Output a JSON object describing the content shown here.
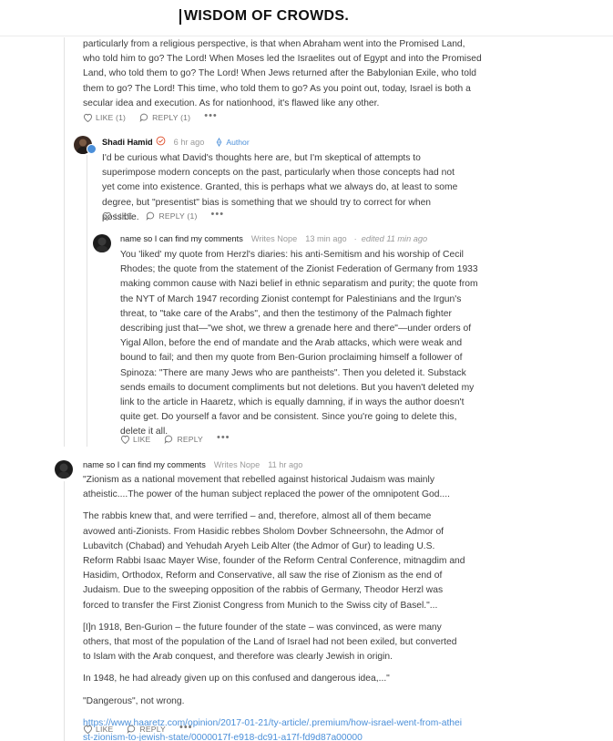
{
  "header": {
    "logo": "WISDOM OF CROWDS."
  },
  "colors": {
    "link": "#4b8fd9",
    "author_badge": "#4b8fd9",
    "verified": "#e05a3a",
    "text": "#363737",
    "muted": "#9a9a9a"
  },
  "comment_top": {
    "text": "particularly from a religious perspective, is that when Abraham went into the Promised Land, who told him to go? The Lord! When Moses led the Israelites out of Egypt and into the Promised Land, who told them to go? The Lord! When Jews returned after the Babylonian Exile, who told them to go? The Lord! This time, who told them to go? As you point out, today, Israel is both a secular idea and execution. As for nationhood, it's flawed like any other.",
    "like_label": "LIKE (1)",
    "reply_label": "REPLY (1)",
    "more": "•••"
  },
  "comment_shadi": {
    "author": "Shadi Hamid",
    "time": "6 hr ago",
    "badge": "Author",
    "text": "I'd be curious what David's thoughts here are, but I'm skeptical of attempts to superimpose modern concepts on the past, particularly when those concepts had not yet come into existence. Granted, this is perhaps what we always do, at least to some degree, but \"presentist\" bias is something that we should try to correct for when possible.",
    "like_label": "LIKE",
    "reply_label": "REPLY (1)",
    "more": "•••"
  },
  "comment_reply": {
    "author": "name so I can find my comments",
    "handle": "Writes Nope",
    "time": "13 min ago",
    "separator": "·",
    "edited": "edited 11 min ago",
    "text": "You 'liked' my quote from Herzl's diaries: his anti-Semitism and his worship of Cecil Rhodes; the quote from the statement of the Zionist Federation of Germany from 1933 making common cause with Nazi belief in ethnic separatism and purity; the quote from the NYT of March 1947 recording Zionist contempt for Palestinians and the Irgun's threat, to \"take care of the Arabs\", and then the testimony of the Palmach fighter describing just that—\"we shot, we threw a grenade here and there\"—under orders of Yigal Allon, before the end of mandate and the Arab attacks, which were weak and bound to fail; and then my quote from Ben-Gurion proclaiming himself a follower of Spinoza: \"There are many Jews who are pantheists\". Then you deleted it. Substack sends emails to document compliments but not deletions. But you haven't deleted my link to the article in Haaretz, which is equally damning, if in ways the author doesn't quite get. Do yourself a favor and be consistent. Since you're going to delete this, delete it all.",
    "like_label": "LIKE",
    "reply_label": "REPLY",
    "more": "•••"
  },
  "comment_bottom": {
    "author": "name so I can find my comments",
    "handle": "Writes Nope",
    "time": "11 hr ago",
    "paragraphs": [
      "\"Zionism as a national movement that rebelled against historical Judaism was mainly atheistic....The power of the human subject replaced the power of the omnipotent God....",
      "The rabbis knew that, and were terrified – and, therefore, almost all of them became avowed anti-Zionists. From Hasidic rebbes Sholom Dovber Schneersohn, the Admor of Lubavitch (Chabad) and Yehudah Aryeh Leib Alter (the Admor of Gur) to leading U.S. Reform Rabbi Isaac Mayer Wise, founder of the Reform Central Conference, mitnagdim and Hasidim, Orthodox, Reform and Conservative, all saw the rise of Zionism as the end of Judaism. Due to the sweeping opposition of the rabbis of Germany, Theodor Herzl was forced to transfer the First Zionist Congress from Munich to the Swiss city of Basel.\"...",
      "[I]n 1918, Ben-Gurion – the future founder of the state – was convinced, as were many others, that most of the population of the Land of Israel had not been exiled, but converted to Islam with the Arab conquest, and therefore was clearly Jewish in origin.",
      "In 1948, he had already given up on this confused and dangerous idea,...\"",
      "\"Dangerous\", not wrong."
    ],
    "link": "https://www.haaretz.com/opinion/2017-01-21/ty-article/.premium/how-israel-went-from-atheist-zionism-to-jewish-state/0000017f-e918-dc91-a17f-fd9d87a00000",
    "like_label": "LIKE",
    "reply_label": "REPLY",
    "more": "•••"
  }
}
